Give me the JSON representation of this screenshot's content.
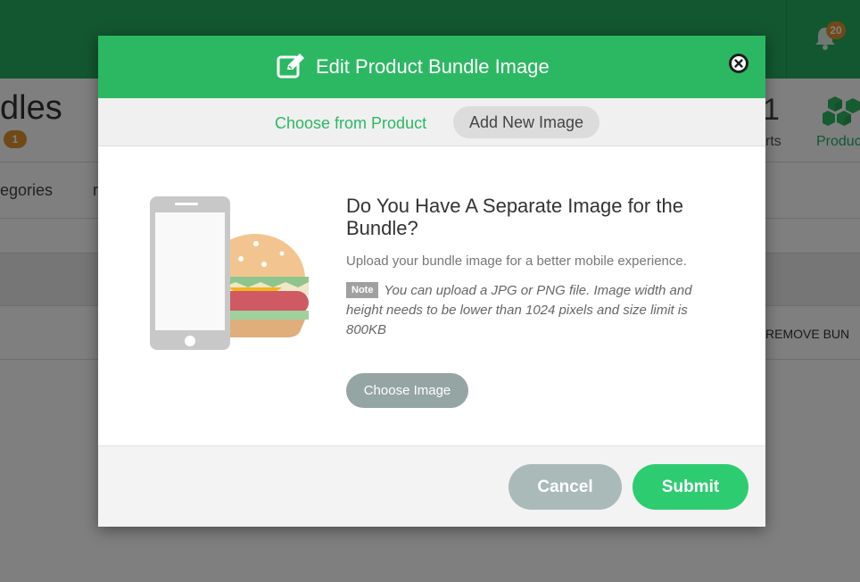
{
  "background": {
    "page_heading": "dles",
    "bundle_count": "1",
    "notification_count": "20",
    "stat_number": "1",
    "stat_label": "rts",
    "products_label": "Produc",
    "tab_categories": "egories",
    "tab_partial": "r",
    "remove_bundle_label": "REMOVE BUN"
  },
  "modal": {
    "title": "Edit Product Bundle Image",
    "tabs": {
      "choose_from_product": "Choose from Product",
      "add_new_image": "Add New Image"
    },
    "heading": "Do You Have A Separate Image for the Bundle?",
    "subtitle": "Upload your bundle image for a better mobile experience.",
    "note_label": "Note",
    "note_text": "You can upload a JPG or PNG file. Image width and height needs to be lower than 1024 pixels and size limit is 800KB",
    "choose_image_label": "Choose Image",
    "cancel_label": "Cancel",
    "submit_label": "Submit"
  },
  "colors": {
    "brand_green": "#2cb863",
    "submit_green": "#2ecc71",
    "badge_orange": "#e0922e",
    "cancel_gray": "#a9bab9"
  }
}
